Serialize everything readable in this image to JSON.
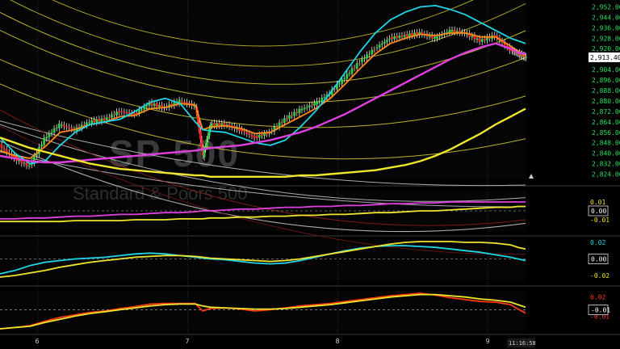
{
  "chart_data": {
    "type": "line",
    "watermark": {
      "symbol": "SP 500",
      "name": "Standard & Poors 500"
    },
    "price_axis": {
      "ticks": [
        "2,952.00",
        "2,944.00",
        "2,936.00",
        "2,928.00",
        "2,920.00",
        "2,904.00",
        "2,896.00",
        "2,888.00",
        "2,880.00",
        "2,872.00",
        "2,864.00",
        "2,856.00",
        "2,848.00",
        "2,840.00",
        "2,832.00",
        "2,824.00"
      ],
      "values": [
        2952,
        2944,
        2936,
        2928,
        2920,
        2904,
        2896,
        2888,
        2880,
        2872,
        2864,
        2856,
        2848,
        2840,
        2832,
        2824
      ],
      "ylim": [
        2820,
        2956
      ],
      "last_price": "2,913.40"
    },
    "x_axis": {
      "ticks": [
        "6",
        "7",
        "8",
        "9"
      ],
      "positions_day": [
        0.25,
        1.25,
        2.25,
        3.25
      ],
      "time_label": "11:16:58"
    },
    "price_series": {
      "x_day": [
        0,
        0.1,
        0.2,
        0.3,
        0.4,
        0.5,
        0.6,
        0.7,
        0.8,
        0.9,
        1.0,
        1.1,
        1.2,
        1.3,
        1.35,
        1.4,
        1.5,
        1.6,
        1.7,
        1.8,
        1.9,
        2.0,
        2.1,
        2.2,
        2.3,
        2.4,
        2.5,
        2.6,
        2.7,
        2.8,
        2.9,
        3.0,
        3.1,
        3.2,
        3.3,
        3.4,
        3.45,
        3.5
      ],
      "close": [
        2846,
        2836,
        2830,
        2851,
        2862,
        2858,
        2864,
        2866,
        2872,
        2870,
        2878,
        2875,
        2880,
        2876,
        2838,
        2862,
        2862,
        2858,
        2852,
        2856,
        2866,
        2873,
        2878,
        2886,
        2898,
        2910,
        2920,
        2928,
        2930,
        2932,
        2928,
        2934,
        2932,
        2926,
        2930,
        2919,
        2916,
        2913.4
      ]
    },
    "overlays": [
      {
        "color": "#ff8c1a",
        "values": [
          2842,
          2838,
          2836,
          2845,
          2856,
          2858,
          2862,
          2864,
          2868,
          2869,
          2874,
          2875,
          2878,
          2877,
          2858,
          2860,
          2861,
          2859,
          2855,
          2856,
          2862,
          2868,
          2874,
          2882,
          2893,
          2905,
          2916,
          2924,
          2928,
          2931,
          2930,
          2932,
          2932,
          2929,
          2929,
          2922,
          2918,
          2915
        ]
      },
      {
        "color": "#1fd5e6",
        "values": [
          2852,
          2840,
          2832,
          2834,
          2846,
          2856,
          2862,
          2864,
          2866,
          2872,
          2879,
          2882,
          2878,
          2864,
          2858,
          2857,
          2856,
          2852,
          2848,
          2846,
          2850,
          2860,
          2872,
          2886,
          2902,
          2918,
          2932,
          2942,
          2948,
          2952,
          2953,
          2950,
          2946,
          2940,
          2934,
          2928,
          2926,
          2924
        ]
      },
      {
        "color": "#e040e0",
        "values": [
          2838,
          2836,
          2834,
          2833,
          2833,
          2834,
          2835,
          2836,
          2837,
          2838,
          2839,
          2840,
          2841,
          2842,
          2843,
          2844,
          2845,
          2846,
          2848,
          2850,
          2853,
          2856,
          2860,
          2865,
          2870,
          2876,
          2882,
          2888,
          2894,
          2900,
          2906,
          2912,
          2917,
          2921,
          2924,
          2920,
          2917,
          2916
        ]
      },
      {
        "color": "#f0e62c",
        "values": [
          2852,
          2848,
          2844,
          2841,
          2838,
          2835,
          2832,
          2830,
          2828,
          2827,
          2826,
          2825,
          2824,
          2823,
          2823,
          2822,
          2822,
          2822,
          2822,
          2822,
          2822,
          2823,
          2823,
          2824,
          2825,
          2826,
          2827,
          2829,
          2831,
          2834,
          2838,
          2843,
          2849,
          2855,
          2862,
          2868,
          2871,
          2874
        ]
      }
    ],
    "indicator_panels": [
      {
        "name": "panel1",
        "ticks": [
          "0.01",
          "0.00",
          "-0.01"
        ],
        "current": "0.00",
        "series": [
          {
            "color": "#e040e0",
            "values": [
              -0.009,
              -0.009,
              -0.008,
              -0.008,
              -0.007,
              -0.006,
              -0.006,
              -0.005,
              -0.004,
              -0.004,
              -0.003,
              -0.002,
              -0.002,
              -0.001,
              0.0,
              0.0,
              0.001,
              0.002,
              0.002,
              0.003,
              0.004,
              0.004,
              0.005,
              0.005,
              0.006,
              0.006,
              0.007,
              0.008,
              0.008,
              0.009,
              0.009,
              0.01,
              0.01,
              0.01,
              0.01,
              0.01,
              0.01,
              0.01
            ]
          },
          {
            "color": "#f0e62c",
            "values": [
              -0.012,
              -0.012,
              -0.012,
              -0.012,
              -0.012,
              -0.011,
              -0.011,
              -0.011,
              -0.011,
              -0.01,
              -0.01,
              -0.01,
              -0.009,
              -0.009,
              -0.009,
              -0.008,
              -0.008,
              -0.007,
              -0.007,
              -0.006,
              -0.006,
              -0.005,
              -0.005,
              -0.004,
              -0.004,
              -0.003,
              -0.002,
              -0.002,
              -0.001,
              0.0,
              0.0,
              0.001,
              0.002,
              0.003,
              0.004,
              0.004,
              0.005,
              0.005
            ]
          }
        ]
      },
      {
        "name": "panel2",
        "ticks": [
          "0.02",
          "0.00",
          "-0.02"
        ],
        "current": "0.00",
        "series": [
          {
            "color": "#1fd5e6",
            "values": [
              -0.018,
              -0.014,
              -0.008,
              -0.004,
              -0.002,
              0.0,
              0.001,
              0.002,
              0.004,
              0.006,
              0.007,
              0.006,
              0.004,
              0.002,
              0.001,
              0.0,
              -0.001,
              -0.003,
              -0.005,
              -0.006,
              -0.005,
              -0.002,
              0.002,
              0.006,
              0.01,
              0.013,
              0.015,
              0.016,
              0.016,
              0.015,
              0.014,
              0.012,
              0.01,
              0.008,
              0.005,
              0.002,
              0.0,
              -0.002
            ]
          },
          {
            "color": "#f0e62c",
            "values": [
              -0.022,
              -0.02,
              -0.017,
              -0.014,
              -0.01,
              -0.007,
              -0.004,
              -0.002,
              0.0,
              0.002,
              0.003,
              0.004,
              0.004,
              0.003,
              0.002,
              0.001,
              0.0,
              -0.001,
              -0.002,
              -0.003,
              -0.002,
              0.0,
              0.003,
              0.006,
              0.009,
              0.012,
              0.015,
              0.018,
              0.02,
              0.021,
              0.021,
              0.021,
              0.02,
              0.02,
              0.019,
              0.017,
              0.014,
              0.012
            ]
          }
        ]
      },
      {
        "name": "panel3",
        "ticks": [
          "0.02",
          "-0.01"
        ],
        "current": "-0.01",
        "series": [
          {
            "color": "#ff3a10",
            "values": [
              -0.03,
              -0.028,
              -0.025,
              -0.018,
              -0.012,
              -0.008,
              -0.004,
              -0.002,
              0.002,
              0.005,
              0.009,
              0.01,
              0.01,
              0.01,
              -0.002,
              0.002,
              0.003,
              0.001,
              -0.002,
              0.0,
              0.003,
              0.006,
              0.008,
              0.01,
              0.013,
              0.016,
              0.019,
              0.022,
              0.024,
              0.026,
              0.023,
              0.019,
              0.016,
              0.013,
              0.012,
              0.008,
              0.001,
              -0.005
            ]
          },
          {
            "color": "#f0e62c",
            "values": [
              -0.03,
              -0.028,
              -0.026,
              -0.02,
              -0.015,
              -0.01,
              -0.006,
              -0.003,
              0.0,
              0.003,
              0.006,
              0.008,
              0.009,
              0.009,
              0.006,
              0.004,
              0.003,
              0.002,
              0.001,
              0.001,
              0.002,
              0.004,
              0.006,
              0.008,
              0.011,
              0.014,
              0.017,
              0.02,
              0.022,
              0.024,
              0.024,
              0.022,
              0.02,
              0.017,
              0.015,
              0.012,
              0.008,
              0.004
            ]
          }
        ]
      }
    ],
    "colors": {
      "background": "#000000",
      "axis_text": "#23e05a",
      "grid": "#2a2a2a",
      "up_candle": "#2ecc40",
      "down_candle": "#ff2020",
      "envelope_upper": "#c9c9c9",
      "envelope_lower": "#d8cf30"
    }
  }
}
